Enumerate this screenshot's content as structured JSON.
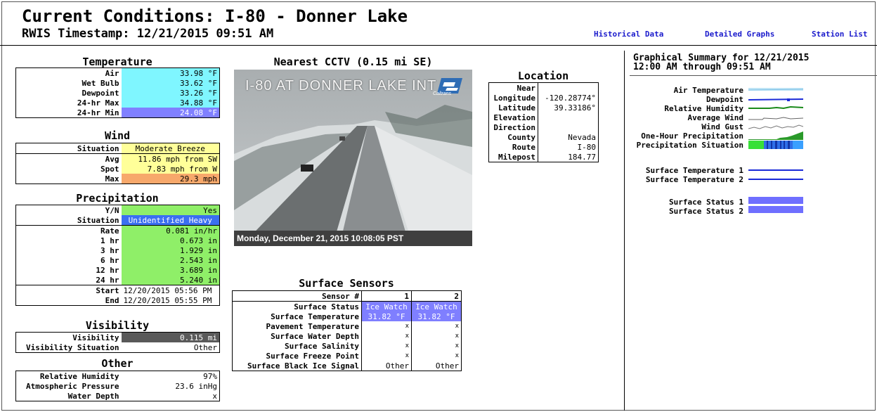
{
  "header": {
    "title": "Current Conditions:  I-80 - Donner Lake",
    "timestamp": "RWIS Timestamp:  12/21/2015 09:51 AM",
    "links": [
      "Historical Data",
      "Detailed Graphs",
      "Station List"
    ]
  },
  "temperature": {
    "heading": "Temperature",
    "rows": [
      {
        "label": "Air",
        "value": "33.98 °F"
      },
      {
        "label": "Wet Bulb",
        "value": "33.62 °F"
      },
      {
        "label": "Dewpoint",
        "value": "33.26 °F"
      },
      {
        "label": "24-hr Max",
        "value": "34.88 °F"
      },
      {
        "label": "24-hr Min",
        "value": "24.08 °F"
      }
    ]
  },
  "wind": {
    "heading": "Wind",
    "situation_label": "Situation",
    "situation": "Moderate Breeze",
    "rows": [
      {
        "label": "Avg",
        "value": "11.86 mph from SW"
      },
      {
        "label": "Spot",
        "value": "7.83 mph from W"
      },
      {
        "label": "Max",
        "value": "29.3 mph"
      }
    ]
  },
  "precipitation": {
    "heading": "Precipitation",
    "yn_label": "Y/N",
    "yn": "Yes",
    "situation_label": "Situation",
    "situation": "Unidentified Heavy",
    "rows": [
      {
        "label": "Rate",
        "value": "0.081 in/hr"
      },
      {
        "label": "1 hr",
        "value": "0.673 in"
      },
      {
        "label": "3 hr",
        "value": "1.929 in"
      },
      {
        "label": "6 hr",
        "value": "2.543 in"
      },
      {
        "label": "12 hr",
        "value": "3.689 in"
      },
      {
        "label": "24 hr",
        "value": "5.240 in"
      }
    ],
    "start_label": "Start",
    "start": "12/20/2015 05:56 PM",
    "end_label": "End",
    "end": "12/20/2015 05:55 PM"
  },
  "visibility": {
    "heading": "Visibility",
    "visibility_label": "Visibility",
    "visibility": "0.115 mi",
    "situation_label": "Visibility Situation",
    "situation": "Other"
  },
  "other": {
    "heading": "Other",
    "rows": [
      {
        "label": "Relative Humidity",
        "value": "97%"
      },
      {
        "label": "Atmospheric Pressure",
        "value": "23.6 inHg"
      },
      {
        "label": "Water Depth",
        "value": "x"
      }
    ]
  },
  "cctv": {
    "heading": "Nearest CCTV (0.15 mi SE)",
    "overlay": "I-80 AT DONNER LAKE INT",
    "logo": "Caltrans",
    "caption": "Monday, December 21, 2015   10:08:05 PST"
  },
  "location": {
    "heading": "Location",
    "rows": [
      {
        "label": "Near",
        "value": ""
      },
      {
        "label": "Longitude",
        "value": "-120.28774°"
      },
      {
        "label": "Latitude",
        "value": "39.33186°"
      },
      {
        "label": "Elevation",
        "value": ""
      },
      {
        "label": "Direction",
        "value": ""
      },
      {
        "label": "County",
        "value": "Nevada"
      },
      {
        "label": "Route",
        "value": "I-80"
      },
      {
        "label": "Milepost",
        "value": "184.77"
      }
    ]
  },
  "surface": {
    "heading": "Surface Sensors",
    "col_header": "Sensor #",
    "sensors": [
      "1",
      "2"
    ],
    "rows": [
      {
        "label": "Surface Status",
        "v1": "Ice Watch",
        "v2": "Ice Watch"
      },
      {
        "label": "Surface Temperature",
        "v1": "31.82 °F",
        "v2": "31.82 °F"
      },
      {
        "label": "Pavement Temperature",
        "v1": "x",
        "v2": "x"
      },
      {
        "label": "Surface Water Depth",
        "v1": "x",
        "v2": "x"
      },
      {
        "label": "Surface Salinity",
        "v1": "x",
        "v2": "x"
      },
      {
        "label": "Surface Freeze Point",
        "v1": "x",
        "v2": "x"
      },
      {
        "label": "Surface Black Ice Signal",
        "v1": "Other",
        "v2": "Other"
      }
    ]
  },
  "summary": {
    "title_line1": "Graphical Summary for 12/21/2015",
    "title_line2": "12:00 AM through 09:51 AM",
    "labels": {
      "air_temperature": "Air Temperature",
      "dewpoint": "Dewpoint",
      "relative_humidity": "Relative Humidity",
      "average_wind": "Average Wind",
      "wind_gust": "Wind Gust",
      "one_hour_precipitation": "One-Hour Precipitation",
      "precipitation_situation": "Precipitation Situation",
      "surface_temperature_1": "Surface Temperature 1",
      "surface_temperature_2": "Surface Temperature 2",
      "surface_status_1": "Surface Status 1",
      "surface_status_2": "Surface Status 2"
    }
  }
}
